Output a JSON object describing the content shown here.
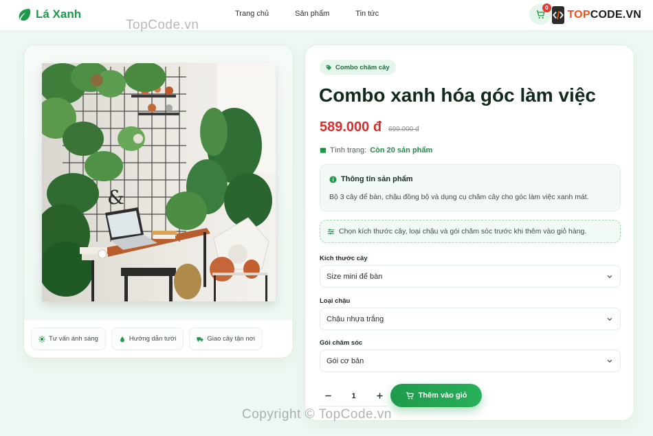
{
  "header": {
    "logo_text": "Lá Xanh",
    "nav": [
      "Trang chủ",
      "Sản phẩm",
      "Tin tức"
    ],
    "cart_count": "0",
    "brand_prefix": "TOP",
    "brand_suffix": "CODE.VN"
  },
  "watermarks": {
    "top": "TopCode.vn",
    "bottom": "Copyright © TopCode.vn"
  },
  "features": [
    {
      "label": "Tư vấn ánh sáng",
      "icon": "gear-icon"
    },
    {
      "label": "Hướng dẫn tưới",
      "icon": "droplet-icon"
    },
    {
      "label": "Giao cây tận nơi",
      "icon": "truck-icon"
    }
  ],
  "product": {
    "category_tag": "Combo chăm cây",
    "title": "Combo xanh hóa góc làm việc",
    "price": "589.000 đ",
    "old_price": "699.000 đ",
    "stock_label": "Tình trạng:",
    "stock_value": "Còn 20 sản phẩm",
    "info_title": "Thông tin sản phẩm",
    "info_desc": "Bộ 3 cây để bàn, chậu đồng bộ và dụng cụ chăm cây cho góc làm việc xanh mát.",
    "hint": "Chọn kích thước cây, loại chậu và gói chăm sóc trước khi thêm vào giỏ hàng.",
    "options": [
      {
        "label": "Kích thước cây",
        "value": "Size mini để bàn"
      },
      {
        "label": "Loại chậu",
        "value": "Chậu nhựa trắng"
      },
      {
        "label": "Gói chăm sóc",
        "value": "Gói cơ bản"
      }
    ],
    "quantity": "1",
    "add_to_cart": "Thêm vào giỏ"
  },
  "colors": {
    "primary": "#1f9a4c",
    "price": "#d32f2f",
    "background": "#eef7f1"
  }
}
